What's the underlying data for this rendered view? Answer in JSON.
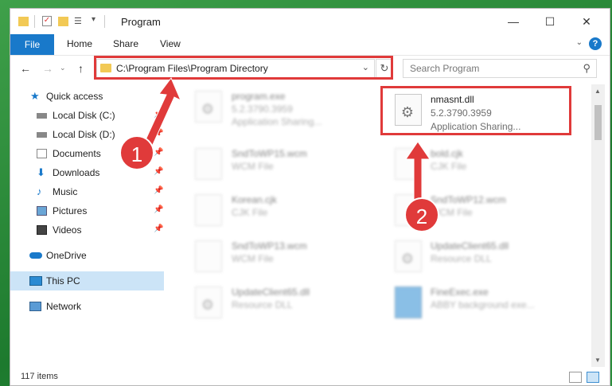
{
  "window": {
    "title": "Program"
  },
  "window_controls": {
    "minimize": "—",
    "maximize": "☐",
    "close": "✕"
  },
  "ribbon": {
    "file": "File",
    "home": "Home",
    "share": "Share",
    "view": "View",
    "help": "?",
    "expand": "⌄"
  },
  "nav": {
    "back": "←",
    "forward": "→",
    "up": "↑",
    "dropdown": "⌄"
  },
  "address": {
    "path": "C:\\Program Files\\Program Directory",
    "dropdown": "⌄",
    "refresh": "↻"
  },
  "search": {
    "placeholder": "Search Program",
    "icon": "⚲"
  },
  "sidebar": {
    "items": [
      {
        "label": "Quick access",
        "icon": "star-icon"
      },
      {
        "label": "Local Disk (C:)",
        "icon": "drive-icon"
      },
      {
        "label": "Local Disk (D:)",
        "icon": "drive-icon"
      },
      {
        "label": "Documents",
        "icon": "documents-icon"
      },
      {
        "label": "Downloads",
        "icon": "download-icon"
      },
      {
        "label": "Music",
        "icon": "music-icon"
      },
      {
        "label": "Pictures",
        "icon": "pictures-icon"
      },
      {
        "label": "Videos",
        "icon": "videos-icon"
      },
      {
        "label": "OneDrive",
        "icon": "cloud-icon"
      },
      {
        "label": "This PC",
        "icon": "pc-icon"
      },
      {
        "label": "Network",
        "icon": "network-icon"
      }
    ],
    "pin": "📌"
  },
  "files": [
    {
      "name": "program.exe",
      "l2": "5.2.3790.3959",
      "l3": "Application Sharing..."
    },
    {
      "name": "nmasnt.dll",
      "l2": "5.2.3790.3959",
      "l3": "Application Sharing..."
    },
    {
      "name": "SndToWP15.wcm",
      "l2": "WCM File"
    },
    {
      "name": "bold.cjk",
      "l2": "CJK File"
    },
    {
      "name": "Korean.cjk",
      "l2": "CJK File"
    },
    {
      "name": "SndToWP12.wcm",
      "l2": "WCM File"
    },
    {
      "name": "SndToWP13.wcm",
      "l2": "WCM File"
    },
    {
      "name": "UpdateClient65.dll",
      "l2": "Resource DLL"
    },
    {
      "name": "UpdateClient65.dll",
      "l2": "Resource DLL"
    },
    {
      "name": "FineExec.exe",
      "l2": "ABBY background exe..."
    }
  ],
  "status": {
    "count": "117 items"
  },
  "badges": {
    "one": "1",
    "two": "2"
  },
  "colors": {
    "accent": "#1979ca",
    "highlight": "#e03a3a",
    "selection": "#cce4f7"
  }
}
